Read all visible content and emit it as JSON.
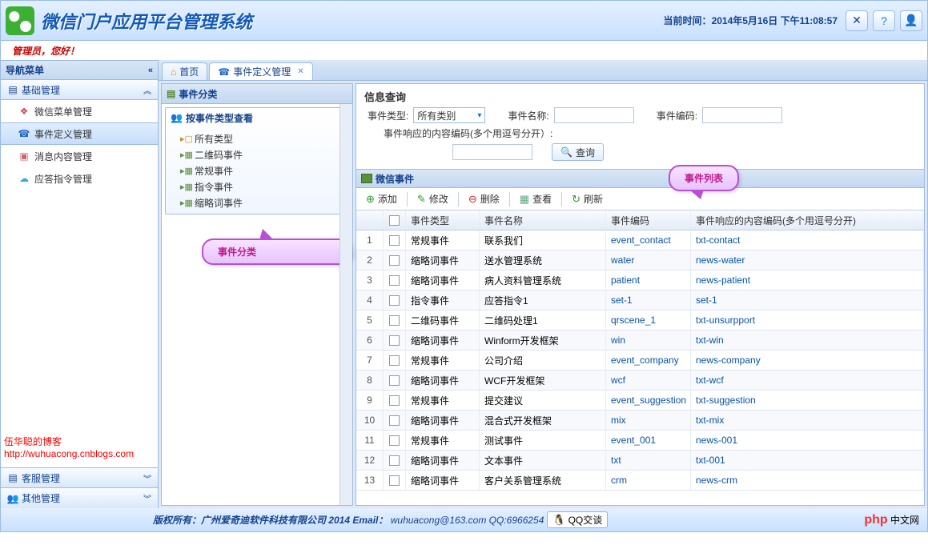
{
  "header": {
    "app_title": "微信门户应用平台管理系统",
    "time_label": "当前时间：",
    "time_value": "2014年5月16日 下午11:08:57"
  },
  "welcome": {
    "text": "管理员，您好！"
  },
  "sidebar": {
    "title": "导航菜单",
    "sections": {
      "basic": {
        "label": "基础管理",
        "expanded": true
      },
      "service": {
        "label": "客服管理"
      },
      "other": {
        "label": "其他管理"
      }
    },
    "basic_items": [
      {
        "label": "微信菜单管理"
      },
      {
        "label": "事件定义管理"
      },
      {
        "label": "消息内容管理"
      },
      {
        "label": "应答指令管理"
      }
    ],
    "blog_link": "伍华聪的博客 http://wuhuacong.cnblogs.com"
  },
  "tabs": {
    "home": "首页",
    "event_def": "事件定义管理"
  },
  "category_panel": {
    "title": "事件分类",
    "group_title": "按事件类型查看",
    "items": [
      {
        "label": "所有类型"
      },
      {
        "label": "二维码事件"
      },
      {
        "label": "常规事件"
      },
      {
        "label": "指令事件"
      },
      {
        "label": "缩略词事件"
      }
    ],
    "callout": "事件分类"
  },
  "search": {
    "title": "信息查询",
    "labels": {
      "type": "事件类型:",
      "name": "事件名称:",
      "code": "事件编码:",
      "resp": "事件响应的内容编码(多个用逗号分开）:"
    },
    "type_value": "所有类别",
    "button": "查询"
  },
  "grid": {
    "title": "微信事件",
    "callout": "事件列表",
    "toolbar": {
      "add": "添加",
      "edit": "修改",
      "del": "删除",
      "view": "查看",
      "refresh": "刷新"
    },
    "columns": {
      "type": "事件类型",
      "name": "事件名称",
      "code": "事件编码",
      "resp": "事件响应的内容编码(多个用逗号分开)"
    },
    "rows": [
      {
        "type": "常规事件",
        "name": "联系我们",
        "code": "event_contact",
        "resp": "txt-contact"
      },
      {
        "type": "缩略词事件",
        "name": "送水管理系统",
        "code": "water",
        "resp": "news-water"
      },
      {
        "type": "缩略词事件",
        "name": "病人资料管理系统",
        "code": "patient",
        "resp": "news-patient"
      },
      {
        "type": "指令事件",
        "name": "应答指令1",
        "code": "set-1",
        "resp": "set-1"
      },
      {
        "type": "二维码事件",
        "name": "二维码处理1",
        "code": "qrscene_1",
        "resp": "txt-unsurpport"
      },
      {
        "type": "缩略词事件",
        "name": "Winform开发框架",
        "code": "win",
        "resp": "txt-win"
      },
      {
        "type": "常规事件",
        "name": "公司介绍",
        "code": "event_company",
        "resp": "news-company"
      },
      {
        "type": "缩略词事件",
        "name": "WCF开发框架",
        "code": "wcf",
        "resp": "txt-wcf"
      },
      {
        "type": "常规事件",
        "name": "提交建议",
        "code": "event_suggestion",
        "resp": "txt-suggestion"
      },
      {
        "type": "缩略词事件",
        "name": "混合式开发框架",
        "code": "mix",
        "resp": "txt-mix"
      },
      {
        "type": "常规事件",
        "name": "测试事件",
        "code": "event_001",
        "resp": "news-001"
      },
      {
        "type": "缩略词事件",
        "name": "文本事件",
        "code": "txt",
        "resp": "txt-001"
      },
      {
        "type": "缩略词事件",
        "name": "客户关系管理系统",
        "code": "crm",
        "resp": "news-crm"
      }
    ]
  },
  "footer": {
    "copyright": "版权所有：广州爱奇迪软件科技有限公司 2014 Email：",
    "email": "wuhuacong@163.com",
    "qq_label": "QQ:6966254",
    "qq_badge": "QQ交谈",
    "phpcn": "中文网"
  }
}
